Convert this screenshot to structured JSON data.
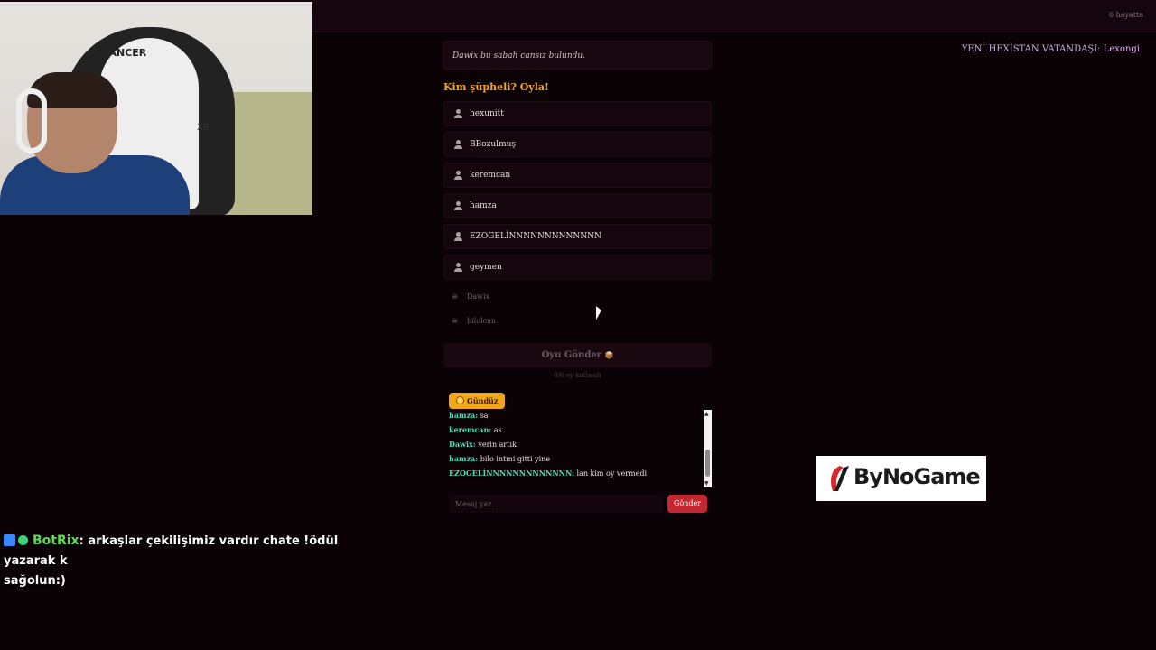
{
  "header": {
    "alive_count": "6 hayatta"
  },
  "announcement": {
    "prefix": "YENİ HEXİSTAN VATANDAŞI:",
    "name": "Lexongi"
  },
  "webcam": {
    "chair_brand": "RANCER",
    "chair_model": "XR"
  },
  "game": {
    "event_text": "Dawix bu sabah cansız bulundu.",
    "vote_title": "Kim şüpheli? Oyla!",
    "alive_players": [
      "hexunitt",
      "BBozulmuş",
      "keremcan",
      "hamza",
      "EZOGELİNNNNNNNNNNNNN",
      "geymen"
    ],
    "dead_players": [
      "Dawix",
      "bilolcan"
    ],
    "submit_label": "Oyu Gönder",
    "submit_emoji": "📦",
    "votes_used": "0/6 oy kullandı",
    "phase_label": "Gündüz"
  },
  "chat": {
    "messages": [
      {
        "user": "hamza:",
        "text": "sa"
      },
      {
        "user": "keremcan:",
        "text": "as"
      },
      {
        "user": "Dawix:",
        "text": "verin artık"
      },
      {
        "user": "hamza:",
        "text": "bilo intmi gitti yine"
      },
      {
        "user": "EZOGELİNNNNNNNNNNNNN:",
        "text": "lan kim oy vermedi"
      }
    ],
    "placeholder": "Mesaj yaz...",
    "send_label": "Gönder"
  },
  "sponsor": {
    "name": "ByNoGame"
  },
  "stream_chat": {
    "user": "BotRix",
    "message": ": arkaşlar çekilişimiz vardır chate !ödül yazarak k",
    "message_cont": "sağolun:)"
  },
  "colors": {
    "accent_orange": "#f5a524",
    "chat_user": "#4fd8b7",
    "send_red": "#c3272f",
    "botrix_green": "#59e04a"
  }
}
